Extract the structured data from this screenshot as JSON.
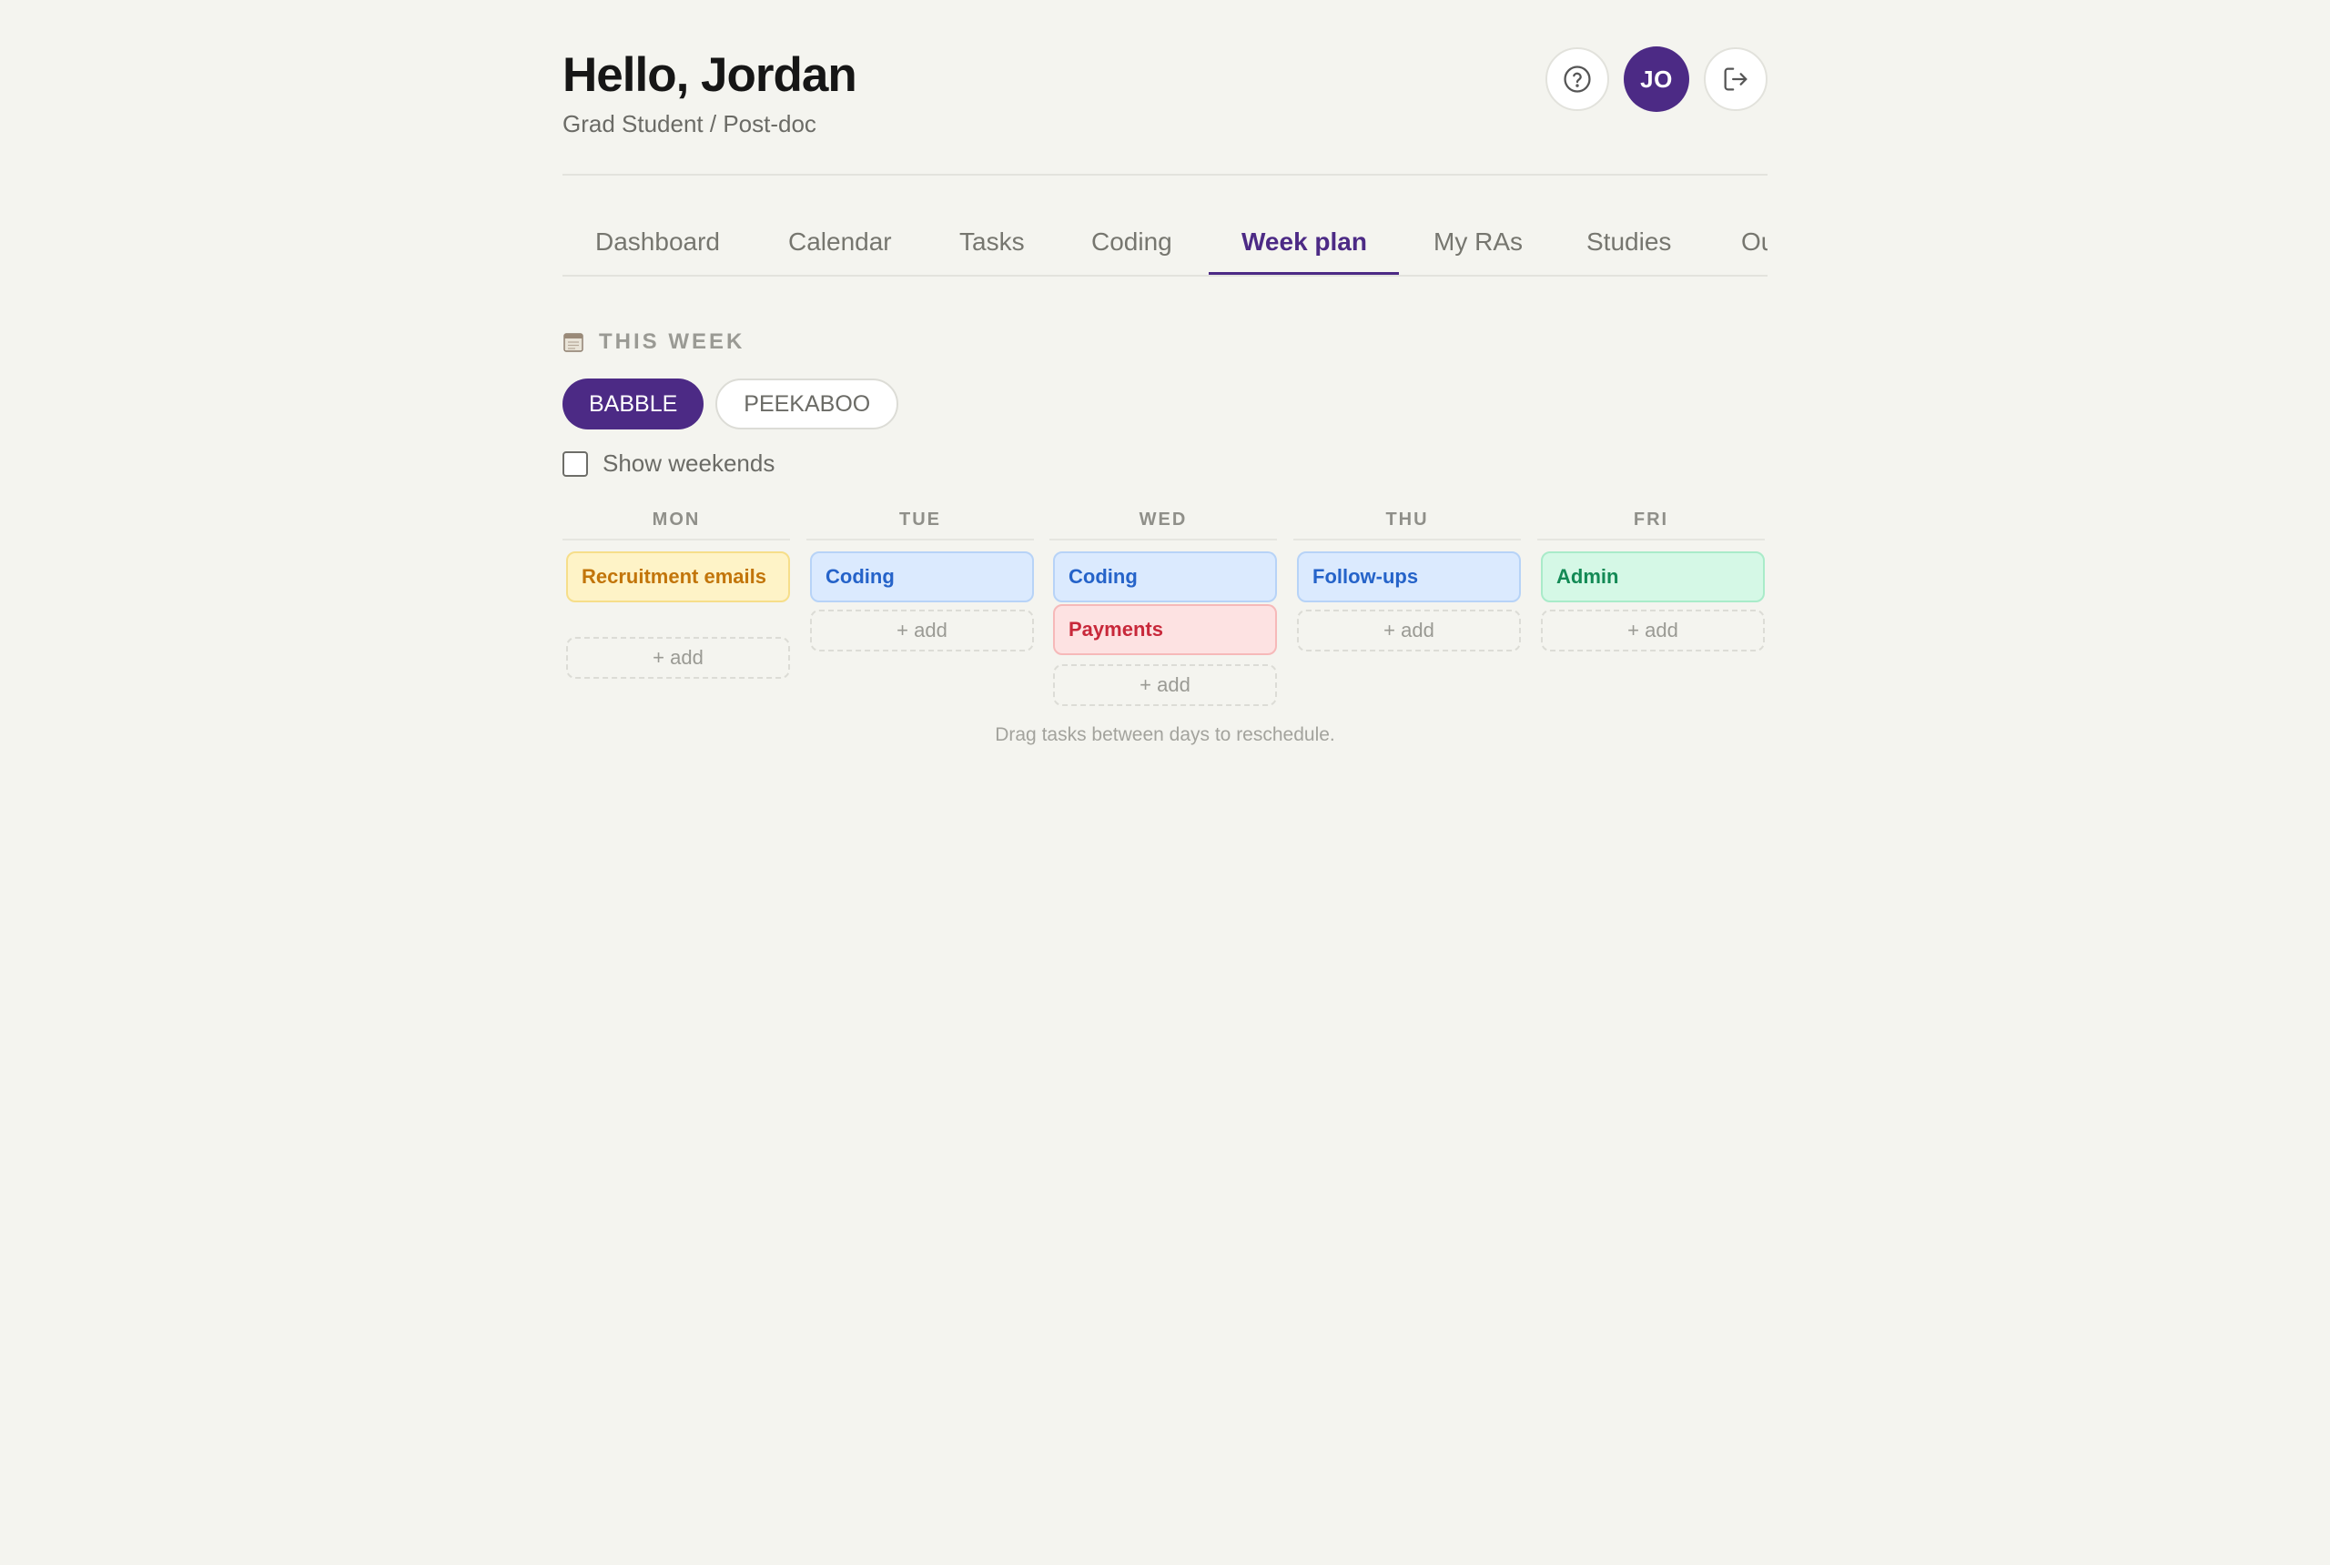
{
  "header": {
    "greeting": "Hello, Jordan",
    "role": "Grad Student / Post-doc",
    "help_icon": "question-circle-icon",
    "avatar_initials": "JO",
    "avatar_color": "#4c2a85",
    "logout_icon": "logout-icon"
  },
  "tabs": [
    {
      "label": "Dashboard",
      "active": false
    },
    {
      "label": "Calendar",
      "active": false
    },
    {
      "label": "Tasks",
      "active": false
    },
    {
      "label": "Coding",
      "active": false
    },
    {
      "label": "Week plan",
      "active": true
    },
    {
      "label": "My RAs",
      "active": false
    },
    {
      "label": "Studies",
      "active": false
    },
    {
      "label": "Ou",
      "active": false
    }
  ],
  "section": {
    "icon": "calendar-icon",
    "title": "THIS WEEK"
  },
  "projects": [
    {
      "label": "BABBLE",
      "active": true
    },
    {
      "label": "PEEKABOO",
      "active": false
    }
  ],
  "weekends_toggle": {
    "label": "Show weekends",
    "checked": false
  },
  "days": [
    {
      "name": "MON",
      "tasks": [
        {
          "label": "Recruitment emails",
          "color": "yellow"
        }
      ],
      "add_label": "+ add"
    },
    {
      "name": "TUE",
      "tasks": [
        {
          "label": "Coding",
          "color": "blue"
        }
      ],
      "add_label": "+ add"
    },
    {
      "name": "WED",
      "tasks": [
        {
          "label": "Coding",
          "color": "blue"
        },
        {
          "label": "Payments",
          "color": "red"
        }
      ],
      "add_label": "+ add"
    },
    {
      "name": "THU",
      "tasks": [
        {
          "label": "Follow-ups",
          "color": "blue"
        }
      ],
      "add_label": "+ add"
    },
    {
      "name": "FRI",
      "tasks": [
        {
          "label": "Admin",
          "color": "green"
        }
      ],
      "add_label": "+ add"
    }
  ],
  "hint": "Drag tasks between days to reschedule.",
  "colors": {
    "accent": "#4c2a85",
    "background": "#f4f4ef",
    "yellow": "#fef3c7",
    "blue": "#dbeafe",
    "red": "#fde2e2",
    "green": "#d5f8e6"
  }
}
